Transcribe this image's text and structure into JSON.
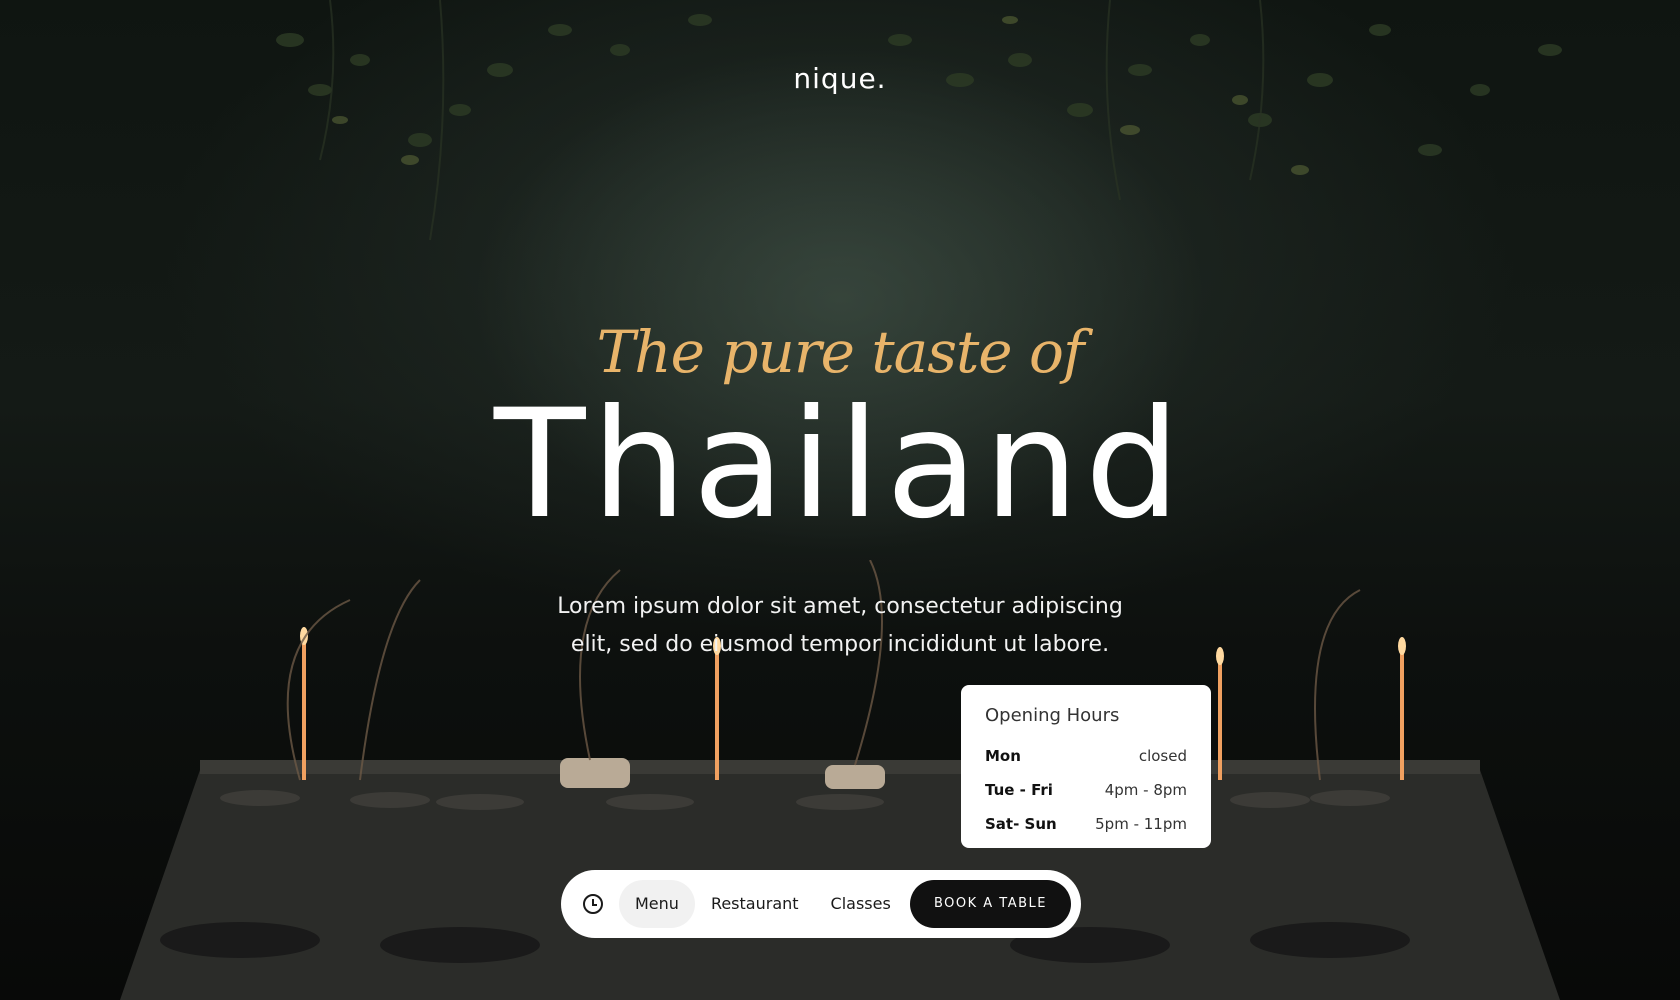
{
  "brand": {
    "logo": "nique."
  },
  "hero": {
    "tagline": "The pure taste of",
    "headline": "Thailand",
    "subtext_line1": "Lorem ipsum dolor sit amet, consectetur adipiscing",
    "subtext_line2": "elit, sed do eiusmod tempor incididunt ut labore."
  },
  "hours": {
    "title": "Opening Hours",
    "rows": [
      {
        "day": "Mon",
        "time": "closed"
      },
      {
        "day": "Tue - Fri",
        "time": "4pm - 8pm"
      },
      {
        "day": "Sat- Sun",
        "time": "5pm - 11pm"
      }
    ]
  },
  "nav": {
    "icon": "clock-icon",
    "items": [
      {
        "label": "Menu",
        "active": true
      },
      {
        "label": "Restaurant",
        "active": false
      },
      {
        "label": "Classes",
        "active": false
      }
    ],
    "cta": "BOOK A TABLE"
  },
  "colors": {
    "accent": "#e8b46a",
    "background": "#0f1511",
    "card": "#ffffff",
    "button": "#111111"
  }
}
